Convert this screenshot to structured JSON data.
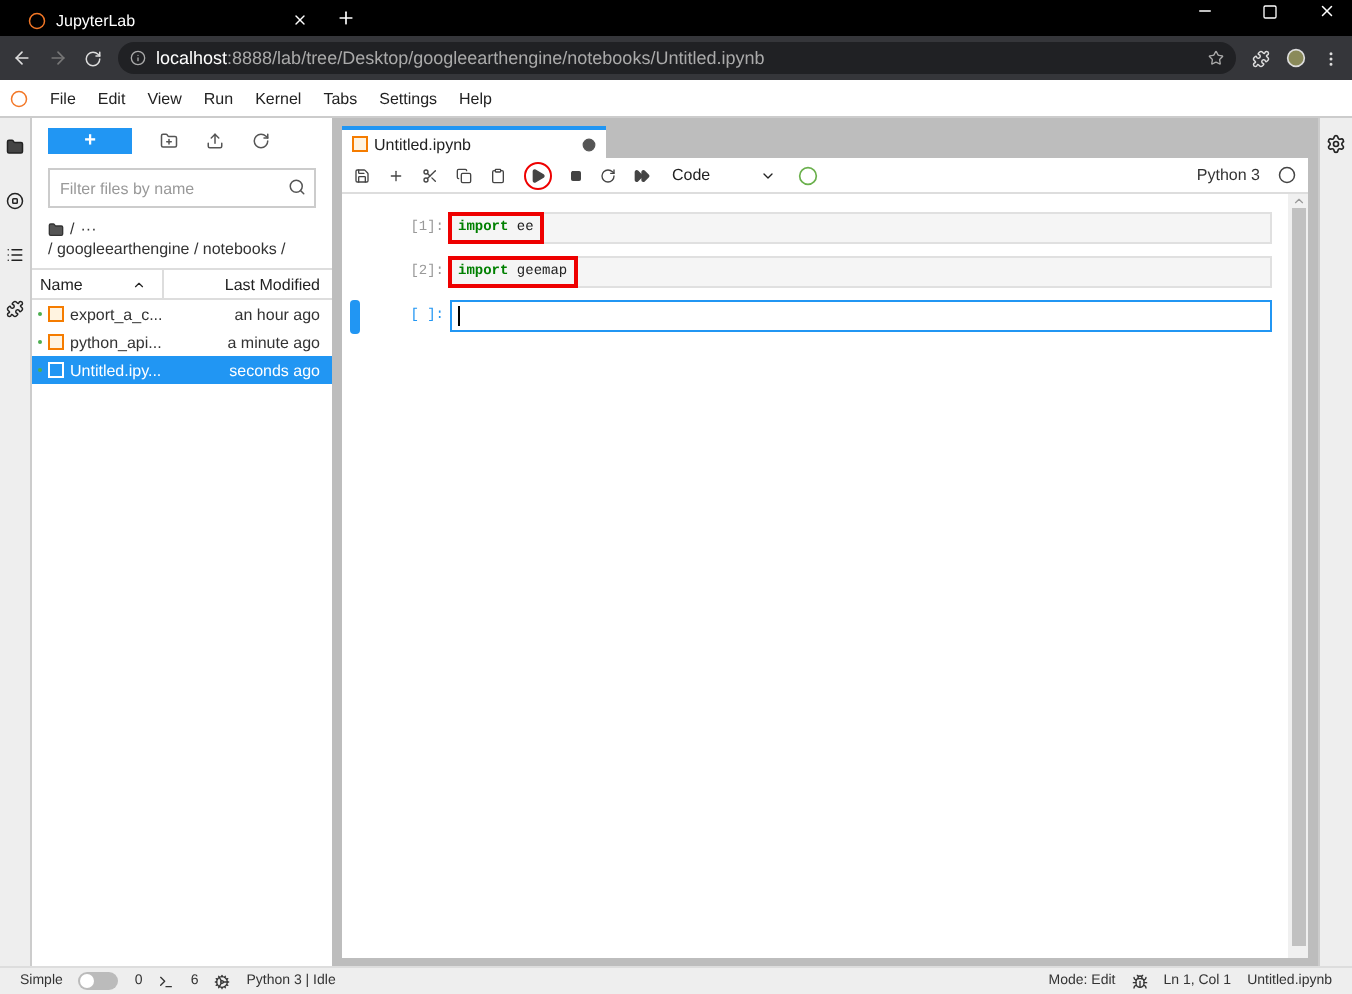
{
  "browser": {
    "tab_title": "JupyterLab",
    "url_host": "localhost",
    "url_rest": ":8888/lab/tree/Desktop/googleearthengine/notebooks/Untitled.ipynb"
  },
  "menu": [
    "File",
    "Edit",
    "View",
    "Run",
    "Kernel",
    "Tabs",
    "Settings",
    "Help"
  ],
  "file_browser": {
    "new_label": "+",
    "filter_placeholder": "Filter files by name",
    "root_path": "/",
    "ellipsis": "···",
    "path": "/ googleearthengine / notebooks /",
    "columns": [
      "Name",
      "Last Modified"
    ],
    "files": [
      {
        "name": "export_a_c...",
        "modified": "an hour ago",
        "running": true,
        "selected": false
      },
      {
        "name": "python_api...",
        "modified": "a minute ago",
        "running": true,
        "selected": false
      },
      {
        "name": "Untitled.ipy...",
        "modified": "seconds ago",
        "running": true,
        "selected": true
      }
    ]
  },
  "notebook": {
    "tab": "Untitled.ipynb",
    "unsaved": true,
    "toolbar": [
      {
        "kind": "save",
        "circled": false
      },
      {
        "kind": "add",
        "circled": false
      },
      {
        "kind": "cut",
        "circled": false
      },
      {
        "kind": "copy",
        "circled": false
      },
      {
        "kind": "paste",
        "circled": false
      },
      {
        "kind": "run",
        "circled": true
      },
      {
        "kind": "stop",
        "circled": false
      },
      {
        "kind": "restart",
        "circled": false
      },
      {
        "kind": "runall",
        "circled": false
      }
    ],
    "cell_type": "Code",
    "kernel": "Python 3",
    "cells": [
      {
        "prompt": "[1]:",
        "keyword": "import",
        "code": "ee",
        "highlighted": true,
        "active": false
      },
      {
        "prompt": "[2]:",
        "keyword": "import",
        "code": "geemap",
        "highlighted": true,
        "active": false
      },
      {
        "prompt": "[ ]:",
        "active": true
      }
    ]
  },
  "status_bar": {
    "mode_label": "Simple",
    "simple_on": false,
    "terminals": "0",
    "kernels": "6",
    "kernel_status": "Python 3 | Idle",
    "mode": "Mode: Edit",
    "position": "Ln 1, Col 1",
    "file": "Untitled.ipynb"
  }
}
